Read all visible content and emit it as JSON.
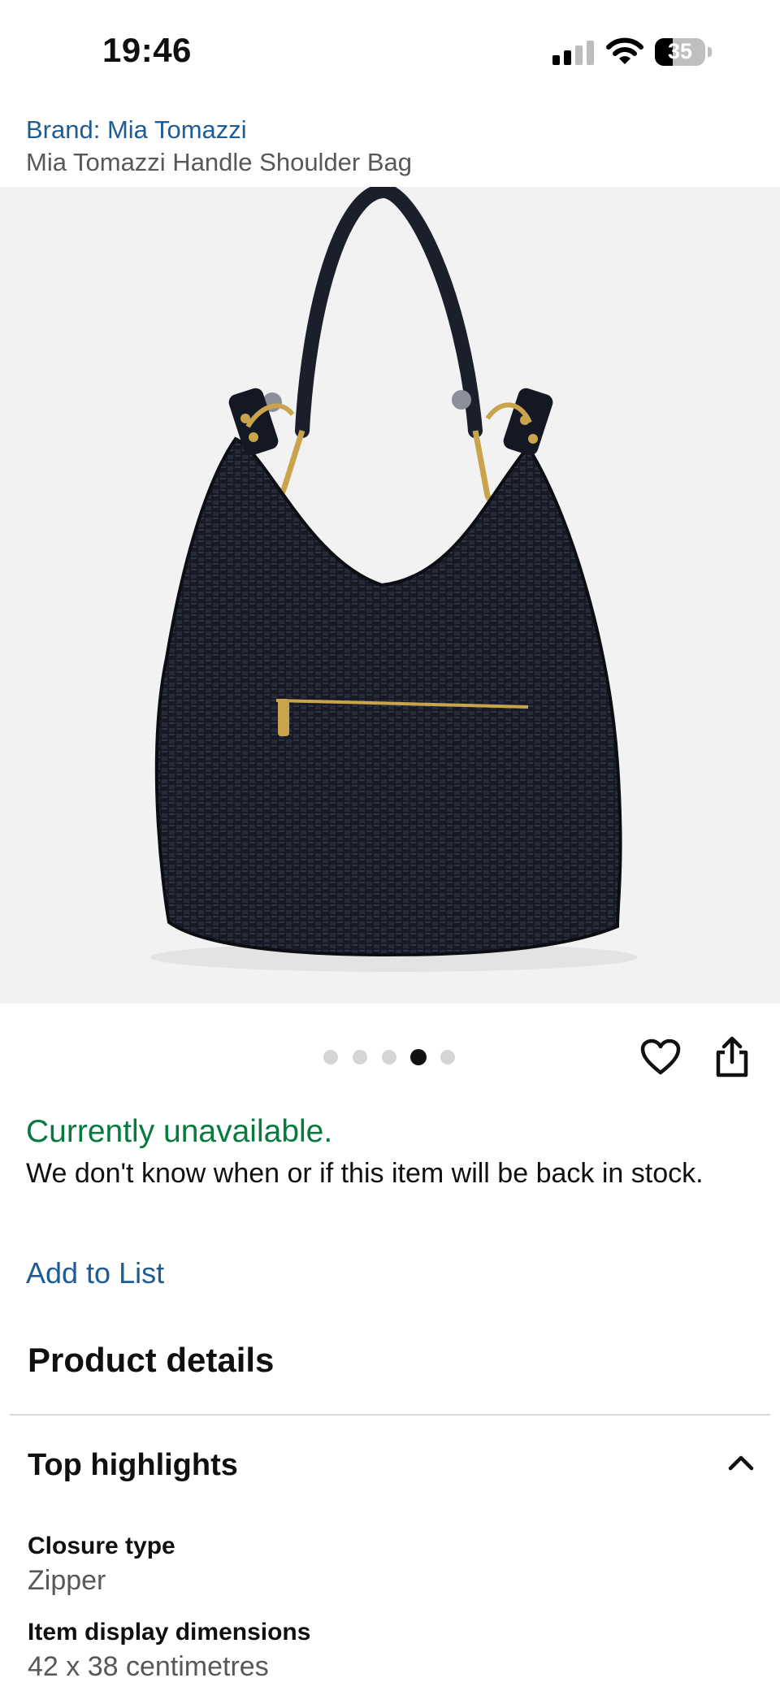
{
  "status_bar": {
    "time": "19:46",
    "battery_level": "35",
    "signal_bars_active": 2,
    "signal_bars_total": 4
  },
  "product": {
    "brand_link": "Brand: Mia Tomazzi",
    "title": "Mia Tomazzi Handle Shoulder Bag",
    "image_icon": "black-woven-shoulder-bag-photo",
    "gallery": {
      "total": 5,
      "current": 4
    }
  },
  "actions": {
    "wishlist_icon": "heart-icon",
    "share_icon": "share-icon",
    "add_to_list": "Add to List"
  },
  "availability": {
    "status": "Currently unavailable.",
    "note": "We don't know when or if this item will be back in stock."
  },
  "details": {
    "section_title": "Product details",
    "highlights_title": "Top highlights",
    "collapse_icon": "chevron-up-icon",
    "specs": [
      {
        "label": "Closure type",
        "value": "Zipper"
      },
      {
        "label": "Item display dimensions",
        "value": "42 x 38 centimetres"
      }
    ]
  },
  "colors": {
    "link_blue": "#1f5c94",
    "availability_green": "#087a3d",
    "secondary_text": "#565959",
    "image_background": "#f2f2f2"
  }
}
